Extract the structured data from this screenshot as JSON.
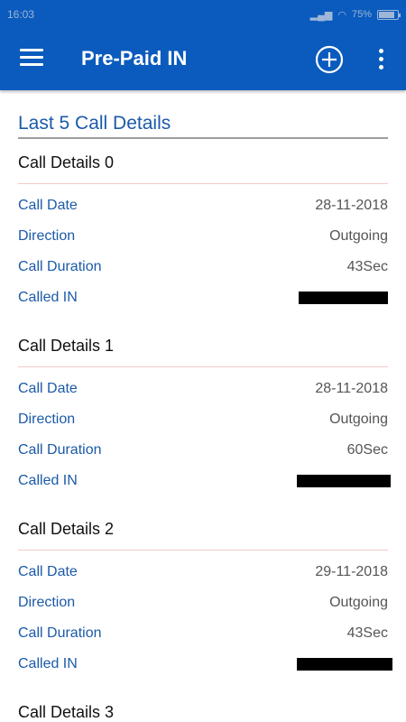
{
  "status": {
    "time": "16:03",
    "battery": "75%",
    "battery_level": 0.75
  },
  "appbar": {
    "title": "Pre-Paid IN",
    "add_icon": "add-circle-icon",
    "menu_icon": "hamburger-menu-icon",
    "more_icon": "more-vertical-icon"
  },
  "section": {
    "title": "Last 5 Call Details"
  },
  "details": [
    {
      "header": "Call Details 0",
      "date_label": "Call Date",
      "date": "28-11-2018",
      "direction_label": "Direction",
      "direction": "Outgoing",
      "duration_label": "Call Duration",
      "duration": "43Sec",
      "called_label": "Called IN"
    },
    {
      "header": "Call Details 1",
      "date_label": "Call Date",
      "date": "28-11-2018",
      "direction_label": "Direction",
      "direction": "Outgoing",
      "duration_label": "Call Duration",
      "duration": "60Sec",
      "called_label": "Called IN"
    },
    {
      "header": "Call Details 2",
      "date_label": "Call Date",
      "date": "29-11-2018",
      "direction_label": "Direction",
      "direction": "Outgoing",
      "duration_label": "Call Duration",
      "duration": "43Sec",
      "called_label": "Called IN"
    },
    {
      "header": "Call Details 3"
    }
  ]
}
